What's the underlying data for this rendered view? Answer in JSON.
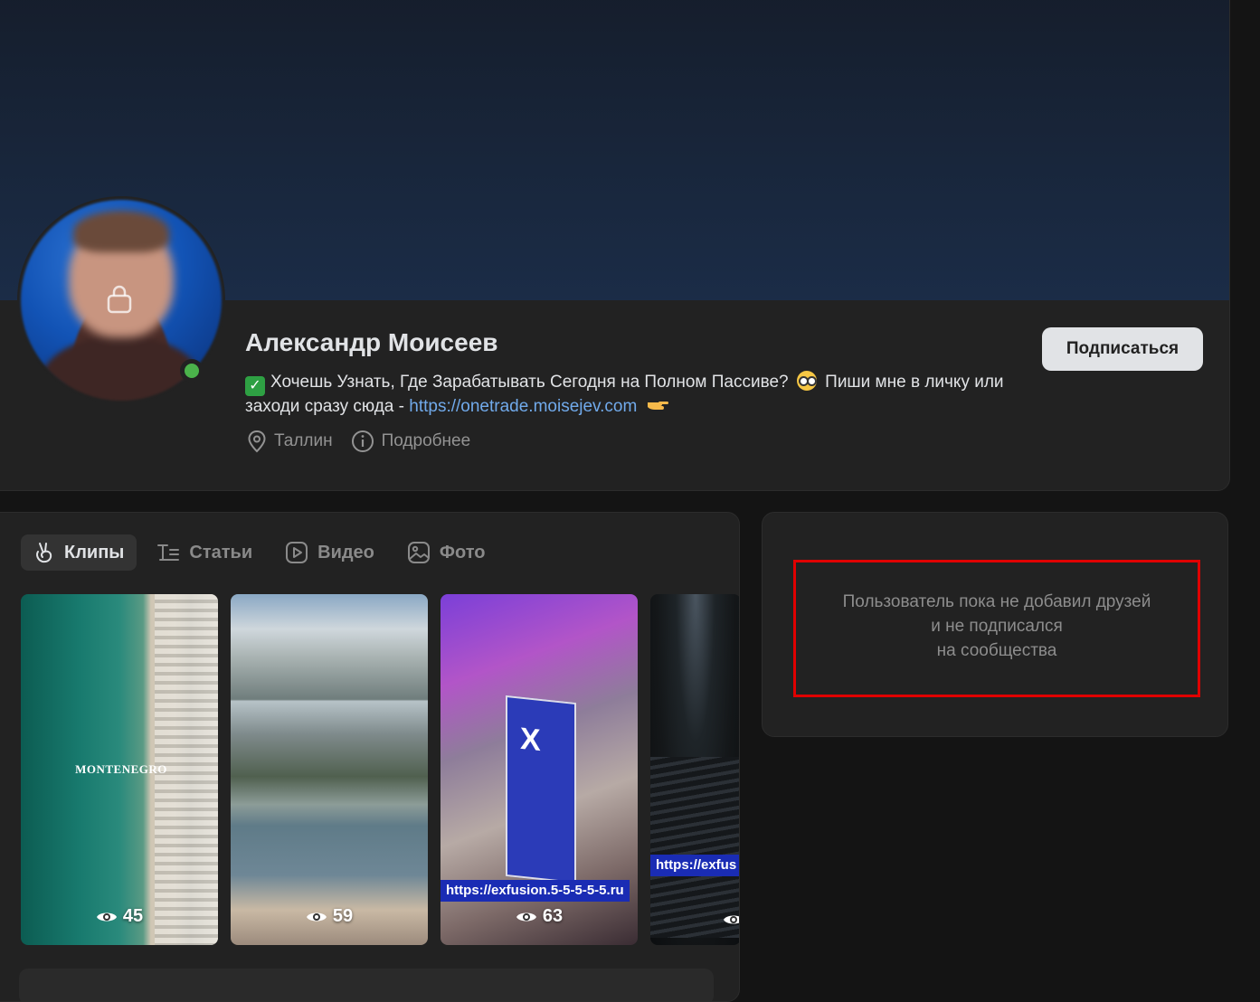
{
  "profile": {
    "name": "Александр Моисеев",
    "status_text_part1": "Хочешь Узнать, Где Зарабатывать Сегодня на Полном Пассиве?",
    "status_text_part2": "Пиши мне в личку или заходи сразу сюда -",
    "status_link": "https://onetrade.moisejev.com",
    "city": "Таллин",
    "more_info": "Подробнее",
    "subscribe_label": "Подписаться",
    "online": true
  },
  "tabs": [
    {
      "label": "Клипы",
      "icon": "clip-icon",
      "active": true
    },
    {
      "label": "Статьи",
      "icon": "articles-icon",
      "active": false
    },
    {
      "label": "Видео",
      "icon": "video-icon",
      "active": false
    },
    {
      "label": "Фото",
      "icon": "photo-icon",
      "active": false
    }
  ],
  "clips": [
    {
      "views": "45",
      "overlay_text": "MONTENEGRO",
      "link_text": ""
    },
    {
      "views": "59",
      "overlay_text": "",
      "link_text": ""
    },
    {
      "views": "63",
      "overlay_text": "",
      "link_text": "https://exfusion.5-5-5-5-5.ru"
    },
    {
      "views": "",
      "overlay_text": "",
      "link_text": "https://exfus"
    }
  ],
  "friends": {
    "empty_line1": "Пользователь пока не добавил друзей",
    "empty_line2": "и не подписался",
    "empty_line3": "на сообщества"
  },
  "colors": {
    "accent_link": "#71aaeb",
    "online": "#4bb34b",
    "highlight_border": "#e00000",
    "card_bg": "#222222"
  }
}
